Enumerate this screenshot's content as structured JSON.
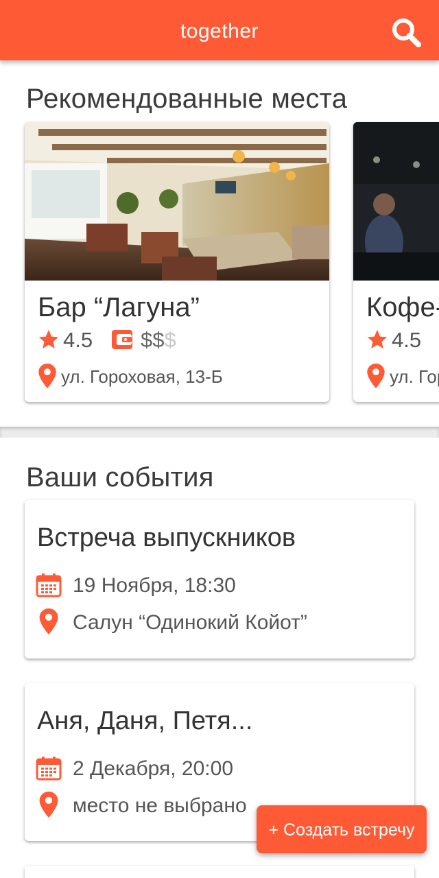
{
  "app": {
    "title": "together"
  },
  "recommended": {
    "title": "Рекомендованные места",
    "places": [
      {
        "name": "Бар “Лагуна”",
        "rating": "4.5",
        "price_active": "$$",
        "price_dim": "$",
        "address": "ул. Гороховая, 13-Б"
      },
      {
        "name": "Кофе-",
        "rating": "4.5",
        "address": "ул. Гор"
      }
    ]
  },
  "events": {
    "title": "Ваши события",
    "items": [
      {
        "title": "Встреча выпускников",
        "date": "19 Ноября, 18:30",
        "place": "Салун “Одинокий Койот”"
      },
      {
        "title": "Аня, Даня, Петя...",
        "date": "2 Декабря, 20:00",
        "place": "место не выбрано"
      }
    ]
  },
  "fab": {
    "label": "+ Создать встречу"
  },
  "colors": {
    "accent": "#ff5a36",
    "text": "#333333",
    "muted": "#c8c8c8"
  },
  "icons": [
    "search-icon",
    "star-icon",
    "wallet-icon",
    "location-pin-icon",
    "calendar-icon"
  ]
}
